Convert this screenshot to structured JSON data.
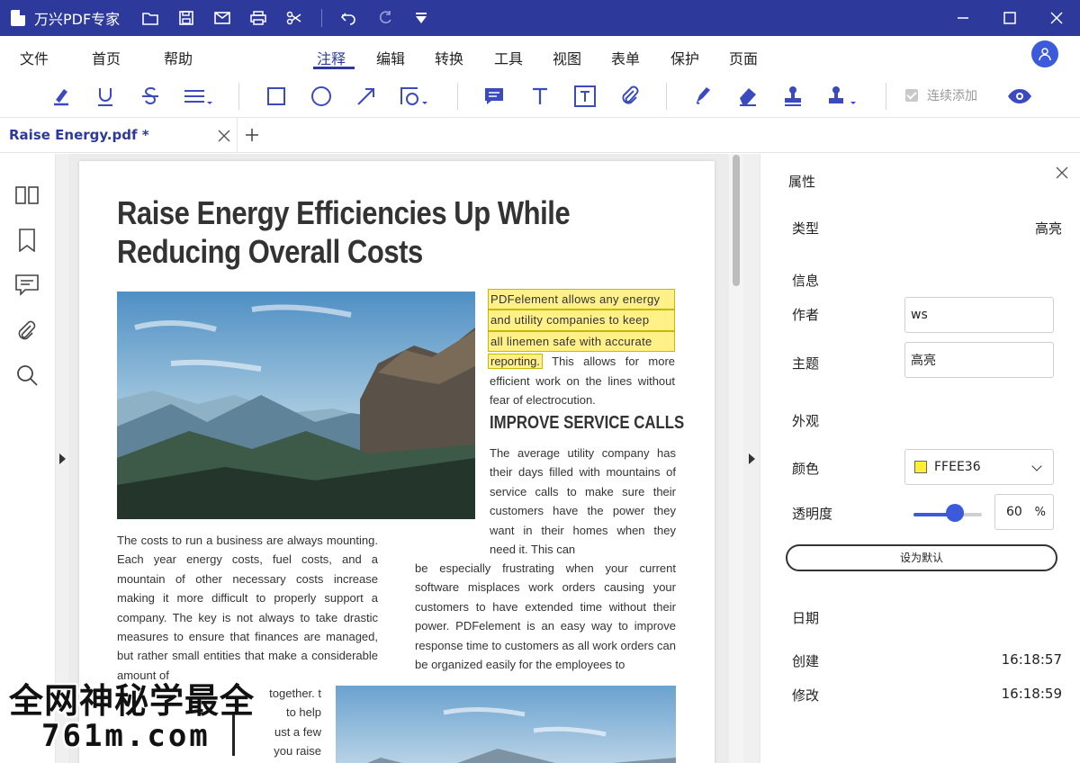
{
  "app": {
    "name": "万兴PDF专家"
  },
  "window": {
    "minimize": "minimize-icon",
    "maximize": "maximize-icon",
    "close": "close-icon"
  },
  "quick_tools": [
    "folder-icon",
    "save-icon",
    "mail-icon",
    "print-icon",
    "share-icon",
    "undo-icon",
    "redo-icon",
    "dropdown-icon"
  ],
  "menu": {
    "items": [
      "文件",
      "首页",
      "帮助",
      "注释",
      "编辑",
      "转换",
      "工具",
      "视图",
      "表单",
      "保护",
      "页面"
    ],
    "active": "注释"
  },
  "toolbar": {
    "continuous_add_label": "连续添加",
    "tools": [
      "highlight-icon",
      "underline-icon",
      "strikethrough-icon",
      "squiggly-icon",
      "rectangle-icon",
      "ellipse-icon",
      "arrow-icon",
      "shape-icon",
      "note-icon",
      "text-icon",
      "textbox-icon",
      "attachment-icon",
      "pencil-icon",
      "eraser-icon",
      "stamp-icon",
      "signature-icon",
      "eye-icon"
    ]
  },
  "tabs": [
    {
      "title": "Raise Energy.pdf *"
    }
  ],
  "sidebar": {
    "items": [
      "thumbnails-icon",
      "bookmark-icon",
      "comment-icon",
      "attachment-icon",
      "search-icon"
    ]
  },
  "document": {
    "title_line1": "Raise Energy Efficiencies Up While",
    "title_line2": "Reducing Overall Costs",
    "highlight_lines": [
      "PDFelement allows any energy",
      "and utility companies to keep",
      "all linemen safe with accurate"
    ],
    "highlight_tail": "reporting.",
    "after_highlight": " This allows for more efficient work on the lines without fear of electrocution.",
    "heading": "IMPROVE SERVICE CALLS",
    "para_right2": "The average utility company has their days filled with mountains of service calls to make sure their customers have the power they want in their homes when they need it. This can",
    "para_right3": "be especially frustrating when your current software misplaces work orders causing your customers to have extended time without their power. PDFelement is an easy way to improve response time to customers as all work orders can be organized easily for the employees to",
    "para_left": "The costs to run a business are always mounting. Each year energy costs, fuel costs, and a mountain of other necessary costs increase making it more difficult to properly support a company. The key is not always to take drastic measures to ensure that finances are managed, but rather small entities that make a considerable amount of",
    "para_left2": "together. t to help ust a few you raise"
  },
  "properties": {
    "title": "属性",
    "type_label": "类型",
    "type_value": "高亮",
    "info_header": "信息",
    "author_label": "作者",
    "author_value": "ws",
    "subject_label": "主题",
    "subject_value": "高亮",
    "appearance_header": "外观",
    "color_label": "颜色",
    "color_value": "FFEE36",
    "opacity_label": "透明度",
    "opacity_value": "60",
    "opacity_unit": "%",
    "default_button": "设为默认",
    "date_header": "日期",
    "created_label": "创建",
    "created_value": "16:18:57",
    "modified_label": "修改",
    "modified_value": "16:18:59"
  },
  "opacity_fraction": 0.6,
  "watermark": {
    "line1": "全网神秘学最全",
    "line2": "761m.com"
  },
  "colors": {
    "brand": "#2d3a9c",
    "accent": "#3b5bdb",
    "highlight": "#FFEE36"
  }
}
